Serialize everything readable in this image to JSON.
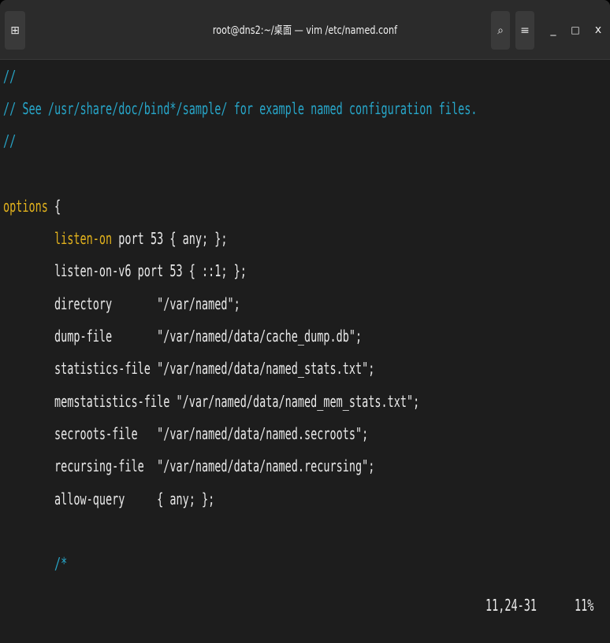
{
  "window": {
    "title": "root@dns2:~/桌面 — vim /etc/named.conf",
    "new_tab_icon": "⊞",
    "search_icon": "⌕",
    "menu_icon": "≡",
    "minimize_icon": "_",
    "maximize_icon": "□",
    "close_icon": "x"
  },
  "lines": [
    [
      {
        "t": "//",
        "c": "comment"
      }
    ],
    [
      {
        "t": "// See /usr/share/doc/bind*/sample/ for example named configuration files.",
        "c": "comment"
      }
    ],
    [
      {
        "t": "//",
        "c": "comment"
      }
    ],
    [],
    [
      {
        "t": "options",
        "c": "key"
      },
      {
        "t": " {",
        "c": "text"
      }
    ],
    [
      {
        "t": "        ",
        "c": "text"
      },
      {
        "t": "listen-on",
        "c": "key"
      },
      {
        "t": " port 53 { any; };",
        "c": "text"
      }
    ],
    [
      {
        "t": "        listen-on-v6 port 53 { ::1; };",
        "c": "text"
      }
    ],
    [
      {
        "t": "        directory       \"/var/named\";",
        "c": "text"
      }
    ],
    [
      {
        "t": "        dump-file       \"/var/named/data/cache_dump.db\";",
        "c": "text"
      }
    ],
    [
      {
        "t": "        statistics-file \"/var/named/data/named_stats.txt\";",
        "c": "text"
      }
    ],
    [
      {
        "t": "        memstatistics-file \"/var/named/data/named_mem_stats.txt\";",
        "c": "text"
      }
    ],
    [
      {
        "t": "        secroots-file   \"/var/named/data/named.secroots\";",
        "c": "text"
      }
    ],
    [
      {
        "t": "        recursing-file  \"/var/named/data/named.recursing\";",
        "c": "text"
      }
    ],
    [
      {
        "t": "        allow-query     { any; };",
        "c": "text"
      }
    ],
    [],
    [
      {
        "t": "        /*",
        "c": "comment"
      }
    ]
  ],
  "status": {
    "position": "11,24-31",
    "percent": "11%"
  },
  "colors": {
    "comment": "#27a6c9",
    "keyword": "#e2b21d",
    "text": "#e9e9e9",
    "background": "#1d1d1d"
  }
}
